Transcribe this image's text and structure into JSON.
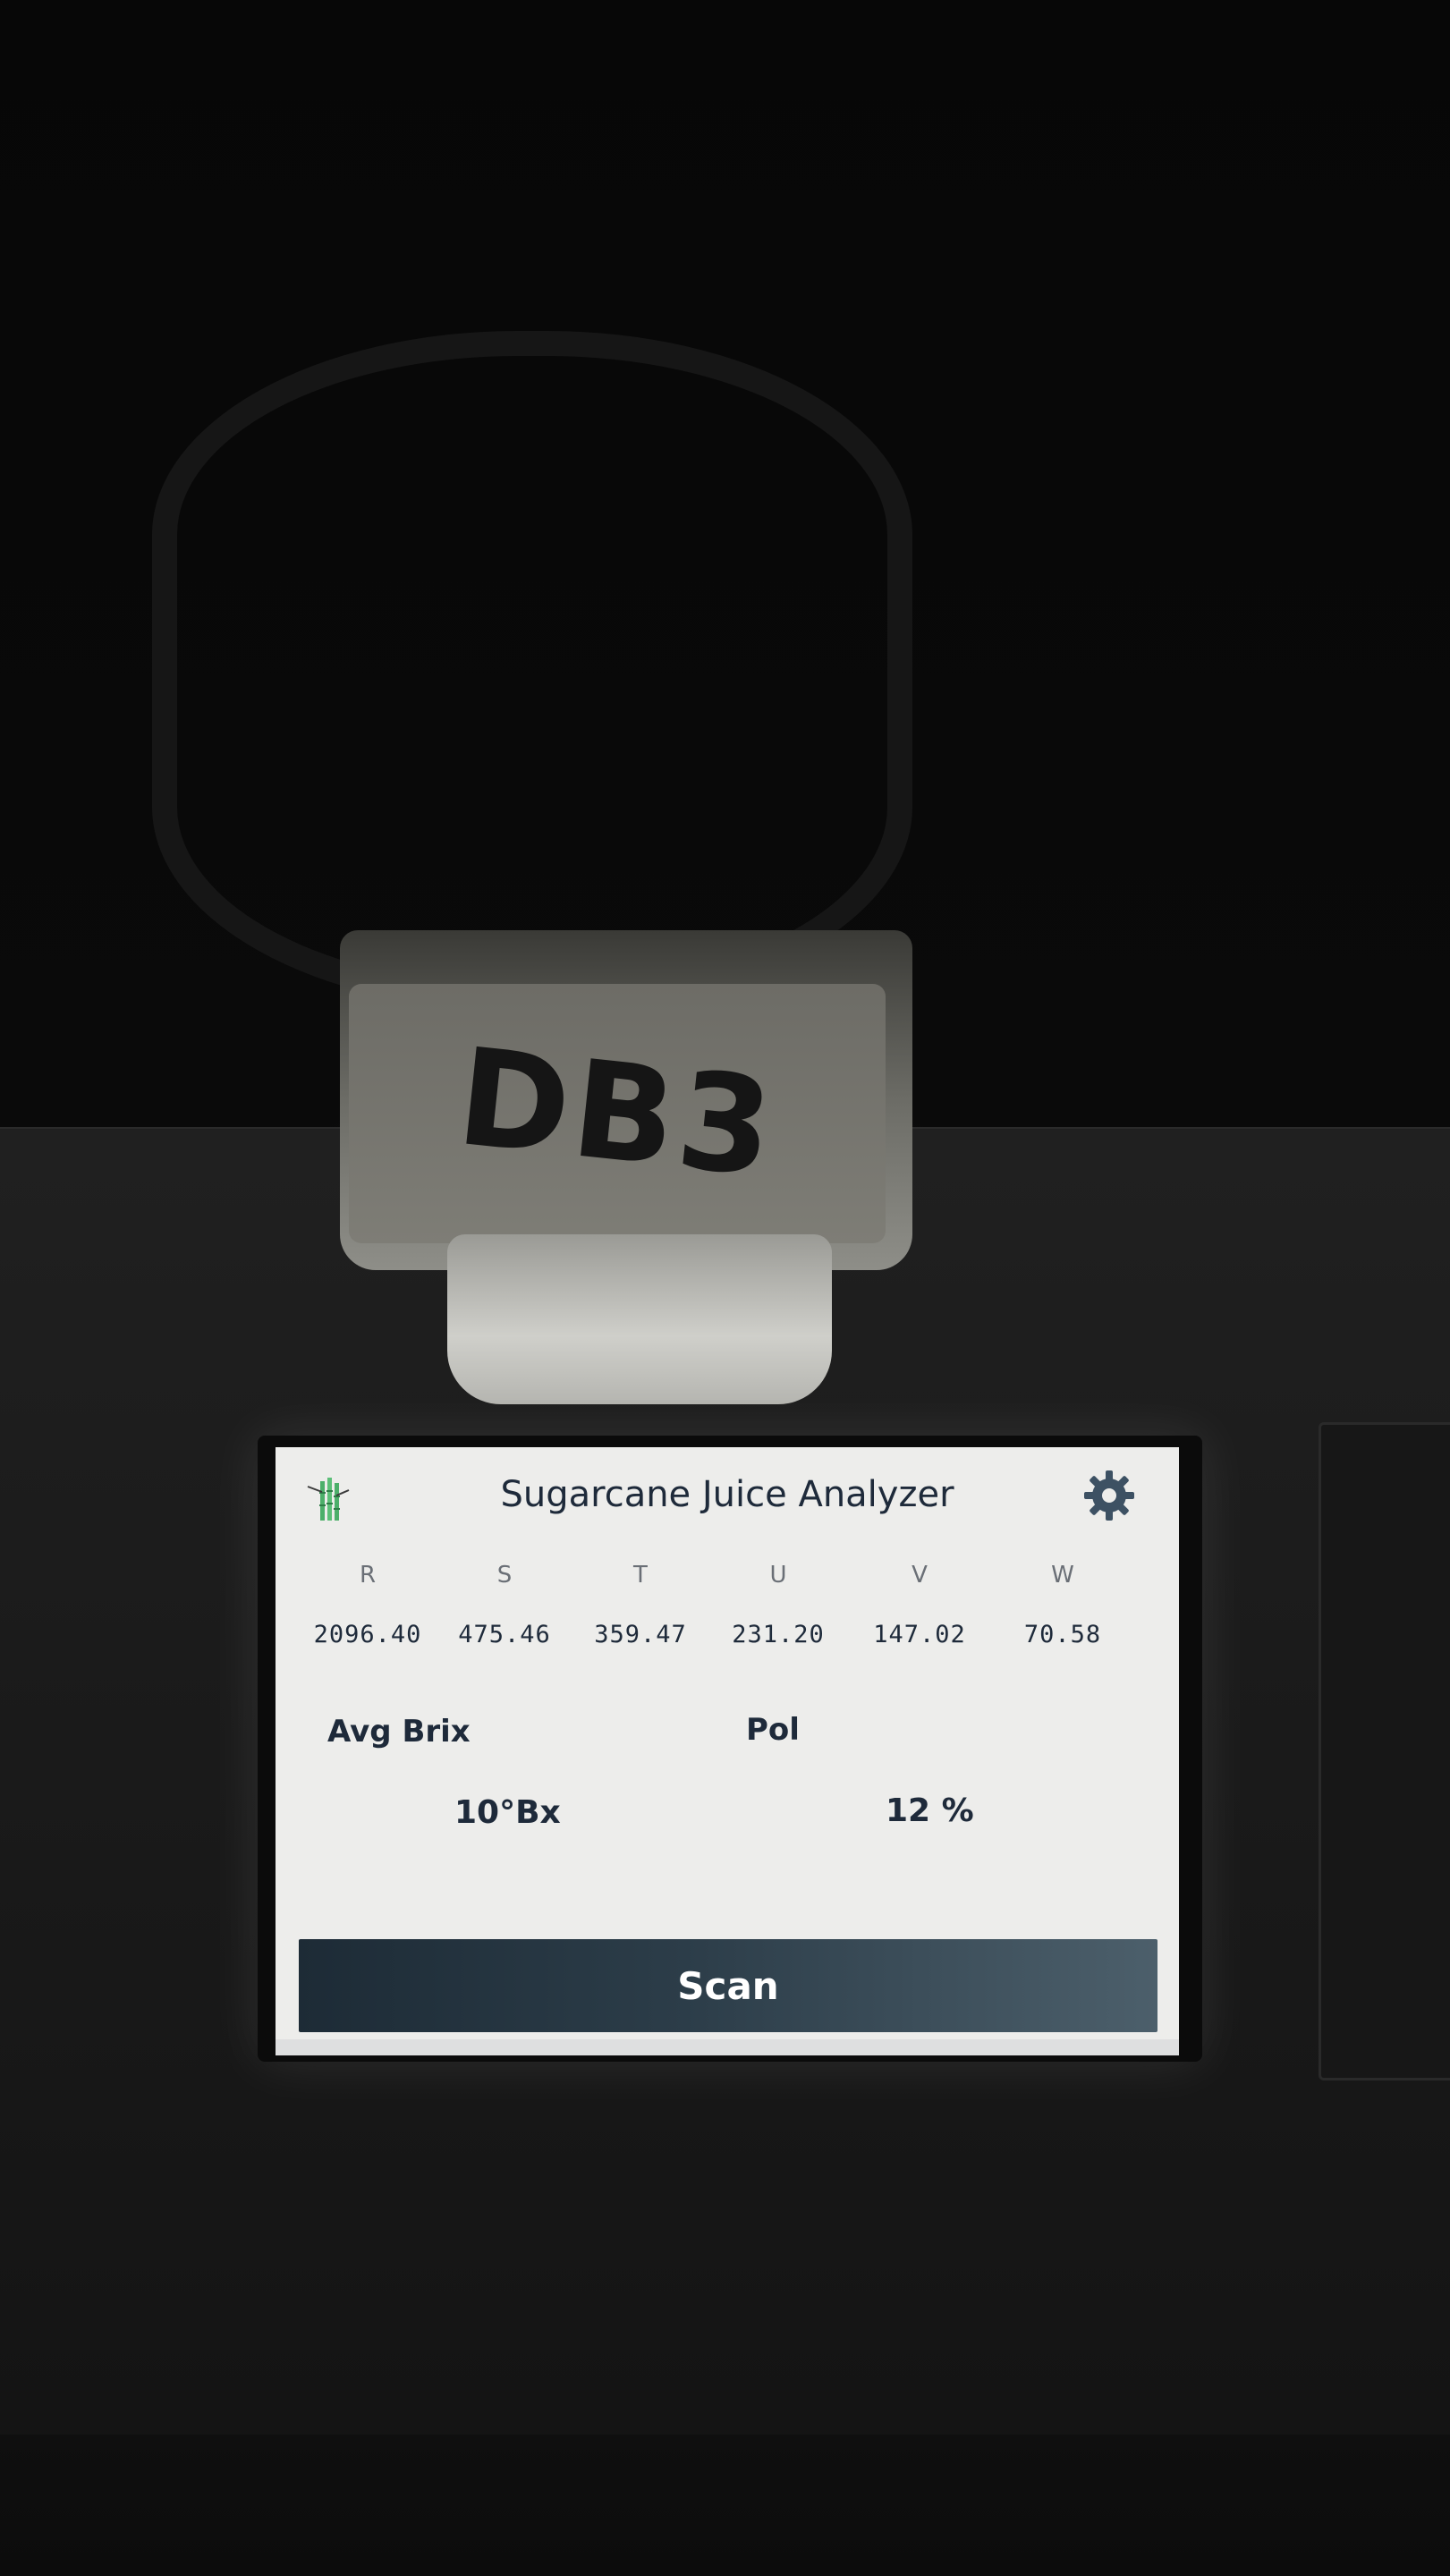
{
  "sample": {
    "container_label": "DB3"
  },
  "header": {
    "title": "Sugarcane Juice Analyzer",
    "logo_icon": "sugarcane-icon",
    "settings_icon": "gear-icon"
  },
  "channels": [
    {
      "label": "R",
      "value": "2096.40"
    },
    {
      "label": "S",
      "value": "475.46"
    },
    {
      "label": "T",
      "value": "359.47"
    },
    {
      "label": "U",
      "value": "231.20"
    },
    {
      "label": "V",
      "value": "147.02"
    },
    {
      "label": "W",
      "value": "70.58"
    }
  ],
  "metrics": {
    "brix_label": "Avg Brix",
    "brix_value": "10°Bx",
    "pol_label": "Pol",
    "pol_value": "12 %"
  },
  "actions": {
    "scan_label": "Scan"
  },
  "colors": {
    "screen_background": "#ededeb",
    "text": "#1e2a3a",
    "scan_button": "#2c3d49",
    "settings_icon": "#3d5163",
    "logo_green": "#4caf6a"
  }
}
